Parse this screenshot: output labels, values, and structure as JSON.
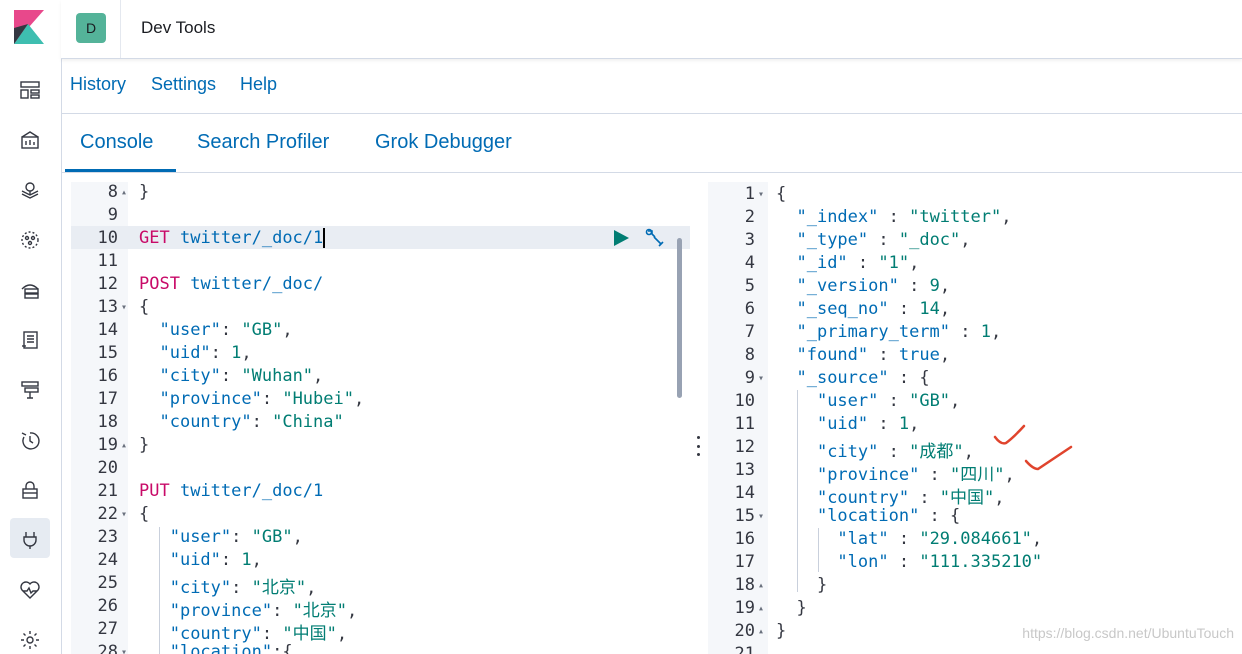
{
  "app": {
    "title": "Dev Tools",
    "space_initial": "D"
  },
  "top_menu": [
    "History",
    "Settings",
    "Help"
  ],
  "tabs": [
    "Console",
    "Search Profiler",
    "Grok Debugger"
  ],
  "active_tab": "Console",
  "left_editor": {
    "lines": [
      {
        "n": "8",
        "fold": "up",
        "tokens": [
          [
            "punc",
            "}"
          ]
        ]
      },
      {
        "n": "9",
        "tokens": []
      },
      {
        "n": "10",
        "highlight": true,
        "tokens": [
          [
            "method",
            "GET"
          ],
          [
            "punc",
            " "
          ],
          [
            "url",
            "twitter/_doc/1"
          ]
        ]
      },
      {
        "n": "11",
        "tokens": []
      },
      {
        "n": "12",
        "tokens": [
          [
            "method",
            "POST"
          ],
          [
            "punc",
            " "
          ],
          [
            "url",
            "twitter/_doc/"
          ]
        ]
      },
      {
        "n": "13",
        "fold": "down",
        "tokens": [
          [
            "punc",
            "{"
          ]
        ]
      },
      {
        "n": "14",
        "tokens": [
          [
            "punc",
            "  "
          ],
          [
            "key",
            "\"user\""
          ],
          [
            "punc",
            ": "
          ],
          [
            "str",
            "\"GB\""
          ],
          [
            "punc",
            ","
          ]
        ]
      },
      {
        "n": "15",
        "tokens": [
          [
            "punc",
            "  "
          ],
          [
            "key",
            "\"uid\""
          ],
          [
            "punc",
            ": "
          ],
          [
            "num",
            "1"
          ],
          [
            "punc",
            ","
          ]
        ]
      },
      {
        "n": "16",
        "tokens": [
          [
            "punc",
            "  "
          ],
          [
            "key",
            "\"city\""
          ],
          [
            "punc",
            ": "
          ],
          [
            "str",
            "\"Wuhan\""
          ],
          [
            "punc",
            ","
          ]
        ]
      },
      {
        "n": "17",
        "tokens": [
          [
            "punc",
            "  "
          ],
          [
            "key",
            "\"province\""
          ],
          [
            "punc",
            ": "
          ],
          [
            "str",
            "\"Hubei\""
          ],
          [
            "punc",
            ","
          ]
        ]
      },
      {
        "n": "18",
        "tokens": [
          [
            "punc",
            "  "
          ],
          [
            "key",
            "\"country\""
          ],
          [
            "punc",
            ": "
          ],
          [
            "str",
            "\"China\""
          ]
        ]
      },
      {
        "n": "19",
        "fold": "up",
        "tokens": [
          [
            "punc",
            "}"
          ]
        ]
      },
      {
        "n": "20",
        "tokens": []
      },
      {
        "n": "21",
        "tokens": [
          [
            "method",
            "PUT"
          ],
          [
            "punc",
            " "
          ],
          [
            "url",
            "twitter/_doc/1"
          ]
        ]
      },
      {
        "n": "22",
        "fold": "down",
        "tokens": [
          [
            "punc",
            "{"
          ]
        ]
      },
      {
        "n": "23",
        "tokens": [
          [
            "punc",
            "   "
          ],
          [
            "key",
            "\"user\""
          ],
          [
            "punc",
            ": "
          ],
          [
            "str",
            "\"GB\""
          ],
          [
            "punc",
            ","
          ]
        ]
      },
      {
        "n": "24",
        "tokens": [
          [
            "punc",
            "   "
          ],
          [
            "key",
            "\"uid\""
          ],
          [
            "punc",
            ": "
          ],
          [
            "num",
            "1"
          ],
          [
            "punc",
            ","
          ]
        ]
      },
      {
        "n": "25",
        "tokens": [
          [
            "punc",
            "   "
          ],
          [
            "key",
            "\"city\""
          ],
          [
            "punc",
            ": "
          ],
          [
            "str",
            "\"北京\""
          ],
          [
            "punc",
            ","
          ]
        ]
      },
      {
        "n": "26",
        "tokens": [
          [
            "punc",
            "   "
          ],
          [
            "key",
            "\"province\""
          ],
          [
            "punc",
            ": "
          ],
          [
            "str",
            "\"北京\""
          ],
          [
            "punc",
            ","
          ]
        ]
      },
      {
        "n": "27",
        "tokens": [
          [
            "punc",
            "   "
          ],
          [
            "key",
            "\"country\""
          ],
          [
            "punc",
            ": "
          ],
          [
            "str",
            "\"中国\""
          ],
          [
            "punc",
            ","
          ]
        ]
      },
      {
        "n": "28",
        "fold": "down",
        "tokens": [
          [
            "punc",
            "   "
          ],
          [
            "key",
            "\"location\""
          ],
          [
            "punc",
            ":{"
          ]
        ]
      }
    ]
  },
  "right_editor": {
    "lines": [
      {
        "n": "1",
        "fold": "down",
        "tokens": [
          [
            "punc",
            "{"
          ]
        ]
      },
      {
        "n": "2",
        "tokens": [
          [
            "punc",
            "  "
          ],
          [
            "key",
            "\"_index\""
          ],
          [
            "punc",
            " : "
          ],
          [
            "str",
            "\"twitter\""
          ],
          [
            "punc",
            ","
          ]
        ]
      },
      {
        "n": "3",
        "tokens": [
          [
            "punc",
            "  "
          ],
          [
            "key",
            "\"_type\""
          ],
          [
            "punc",
            " : "
          ],
          [
            "str",
            "\"_doc\""
          ],
          [
            "punc",
            ","
          ]
        ]
      },
      {
        "n": "4",
        "tokens": [
          [
            "punc",
            "  "
          ],
          [
            "key",
            "\"_id\""
          ],
          [
            "punc",
            " : "
          ],
          [
            "str",
            "\"1\""
          ],
          [
            "punc",
            ","
          ]
        ]
      },
      {
        "n": "5",
        "tokens": [
          [
            "punc",
            "  "
          ],
          [
            "key",
            "\"_version\""
          ],
          [
            "punc",
            " : "
          ],
          [
            "num",
            "9"
          ],
          [
            "punc",
            ","
          ]
        ]
      },
      {
        "n": "6",
        "tokens": [
          [
            "punc",
            "  "
          ],
          [
            "key",
            "\"_seq_no\""
          ],
          [
            "punc",
            " : "
          ],
          [
            "num",
            "14"
          ],
          [
            "punc",
            ","
          ]
        ]
      },
      {
        "n": "7",
        "tokens": [
          [
            "punc",
            "  "
          ],
          [
            "key",
            "\"_primary_term\""
          ],
          [
            "punc",
            " : "
          ],
          [
            "num",
            "1"
          ],
          [
            "punc",
            ","
          ]
        ]
      },
      {
        "n": "8",
        "tokens": [
          [
            "punc",
            "  "
          ],
          [
            "key",
            "\"found\""
          ],
          [
            "punc",
            " : "
          ],
          [
            "bool",
            "true"
          ],
          [
            "punc",
            ","
          ]
        ]
      },
      {
        "n": "9",
        "fold": "down",
        "tokens": [
          [
            "punc",
            "  "
          ],
          [
            "key",
            "\"_source\""
          ],
          [
            "punc",
            " : {"
          ]
        ]
      },
      {
        "n": "10",
        "tokens": [
          [
            "punc",
            "    "
          ],
          [
            "key",
            "\"user\""
          ],
          [
            "punc",
            " : "
          ],
          [
            "str",
            "\"GB\""
          ],
          [
            "punc",
            ","
          ]
        ]
      },
      {
        "n": "11",
        "tokens": [
          [
            "punc",
            "    "
          ],
          [
            "key",
            "\"uid\""
          ],
          [
            "punc",
            " : "
          ],
          [
            "num",
            "1"
          ],
          [
            "punc",
            ","
          ]
        ]
      },
      {
        "n": "12",
        "tokens": [
          [
            "punc",
            "    "
          ],
          [
            "key",
            "\"city\""
          ],
          [
            "punc",
            " : "
          ],
          [
            "str",
            "\"成都\""
          ],
          [
            "punc",
            ","
          ]
        ]
      },
      {
        "n": "13",
        "tokens": [
          [
            "punc",
            "    "
          ],
          [
            "key",
            "\"province\""
          ],
          [
            "punc",
            " : "
          ],
          [
            "str",
            "\"四川\""
          ],
          [
            "punc",
            ","
          ]
        ]
      },
      {
        "n": "14",
        "tokens": [
          [
            "punc",
            "    "
          ],
          [
            "key",
            "\"country\""
          ],
          [
            "punc",
            " : "
          ],
          [
            "str",
            "\"中国\""
          ],
          [
            "punc",
            ","
          ]
        ]
      },
      {
        "n": "15",
        "fold": "down",
        "tokens": [
          [
            "punc",
            "    "
          ],
          [
            "key",
            "\"location\""
          ],
          [
            "punc",
            " : {"
          ]
        ]
      },
      {
        "n": "16",
        "tokens": [
          [
            "punc",
            "      "
          ],
          [
            "key",
            "\"lat\""
          ],
          [
            "punc",
            " : "
          ],
          [
            "str",
            "\"29.084661\""
          ],
          [
            "punc",
            ","
          ]
        ]
      },
      {
        "n": "17",
        "tokens": [
          [
            "punc",
            "      "
          ],
          [
            "key",
            "\"lon\""
          ],
          [
            "punc",
            " : "
          ],
          [
            "str",
            "\"111.335210\""
          ]
        ]
      },
      {
        "n": "18",
        "fold": "up",
        "tokens": [
          [
            "punc",
            "    }"
          ]
        ]
      },
      {
        "n": "19",
        "fold": "up",
        "tokens": [
          [
            "punc",
            "  }"
          ]
        ]
      },
      {
        "n": "20",
        "fold": "up",
        "tokens": [
          [
            "punc",
            "}"
          ]
        ]
      },
      {
        "n": "21",
        "tokens": []
      }
    ]
  },
  "watermark": "https://blog.csdn.net/UbuntuTouch",
  "colors": {
    "accent": "#006bb4",
    "method": "#c80a68",
    "string": "#017d73",
    "avatar": "#54b399",
    "annotation": "#e0442d"
  },
  "nav_icons": [
    "dashboard-icon",
    "canvas-icon",
    "maps-icon",
    "ml-icon",
    "infrastructure-icon",
    "logs-icon",
    "apm-icon",
    "uptime-icon",
    "siem-icon",
    "dev-tools-icon",
    "monitoring-icon",
    "management-icon"
  ]
}
